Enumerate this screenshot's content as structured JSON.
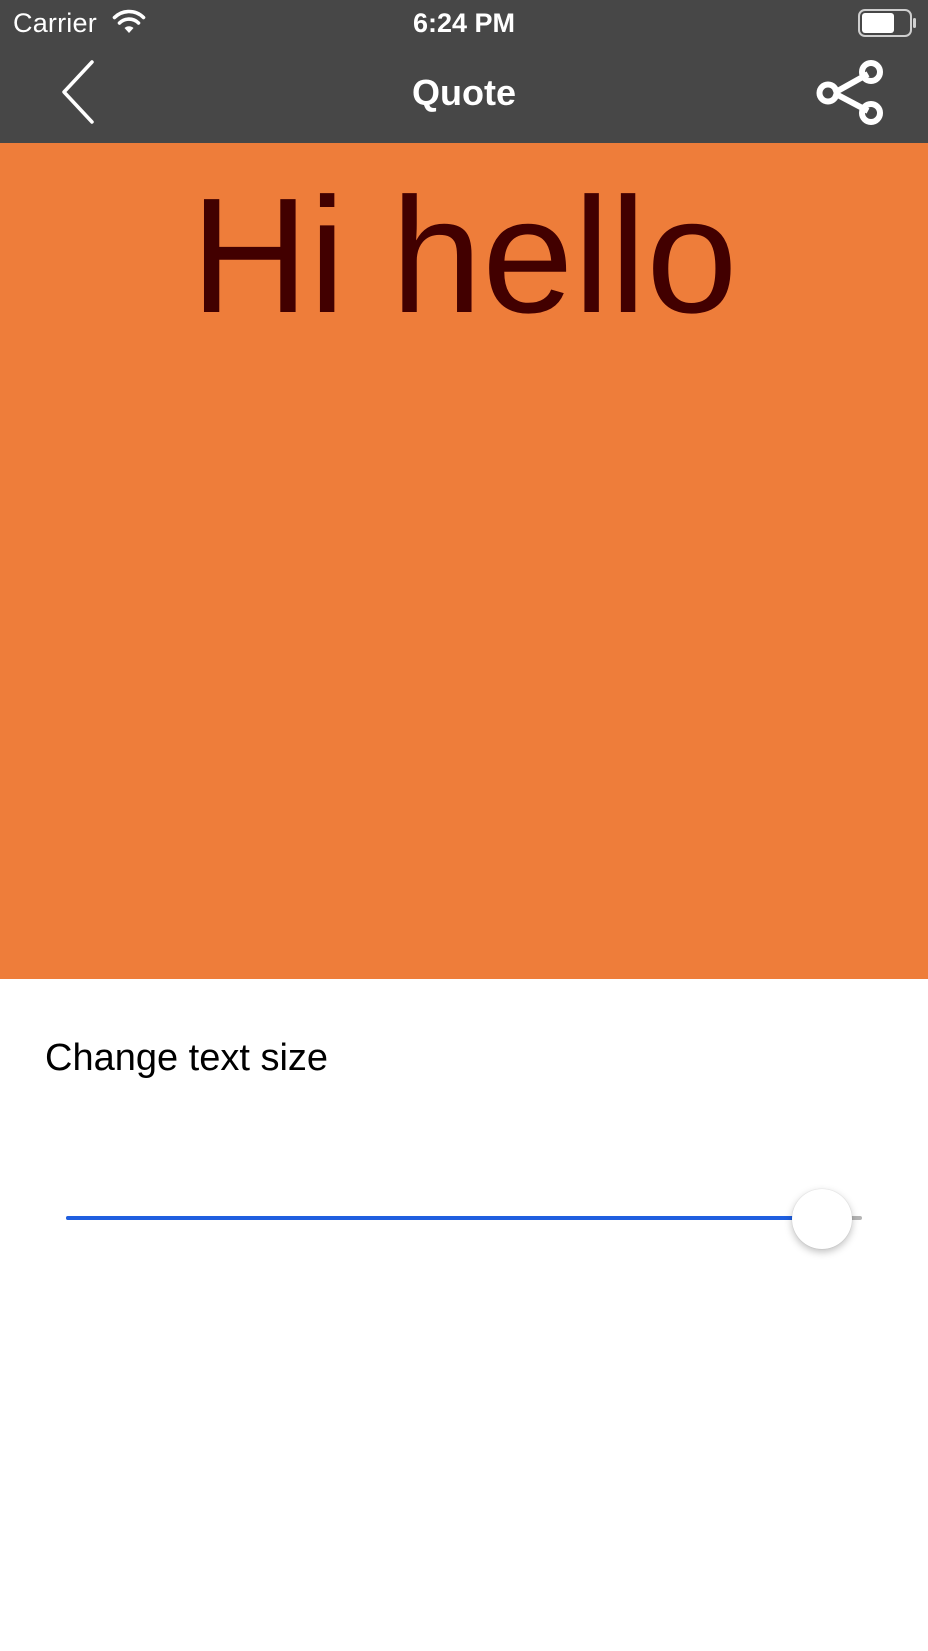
{
  "status_bar": {
    "carrier": "Carrier",
    "time": "6:24 PM",
    "battery_level": 0.7
  },
  "nav": {
    "title": "Quote",
    "back_icon": "chevron-left-icon",
    "share_icon": "share-icon"
  },
  "quote": {
    "text": "Hi hello",
    "background_color": "#ee7d3a",
    "text_color": "#420000"
  },
  "controls": {
    "text_size_label": "Change text size",
    "slider_value": 0.95,
    "slider_color": "#1f5fe0"
  },
  "colors": {
    "nav_background": "#474747"
  }
}
